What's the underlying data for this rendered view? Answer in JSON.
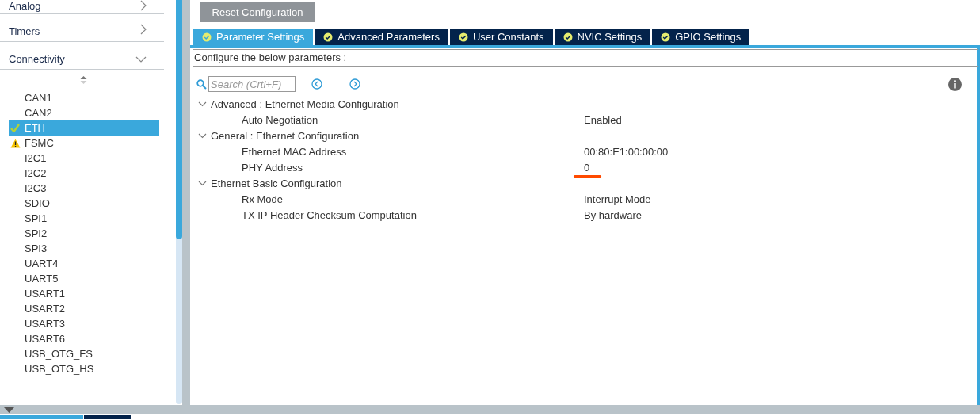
{
  "sidebar": {
    "categories": [
      {
        "label": "Analog",
        "expanded": false
      },
      {
        "label": "Timers",
        "expanded": false
      },
      {
        "label": "Connectivity",
        "expanded": true
      }
    ],
    "items": [
      {
        "label": "CAN1",
        "kind": "none",
        "selected": false
      },
      {
        "label": "CAN2",
        "kind": "none",
        "selected": false
      },
      {
        "label": "ETH",
        "kind": "ok",
        "selected": true
      },
      {
        "label": "FSMC",
        "kind": "warning",
        "selected": false
      },
      {
        "label": "I2C1",
        "kind": "none",
        "selected": false
      },
      {
        "label": "I2C2",
        "kind": "none",
        "selected": false
      },
      {
        "label": "I2C3",
        "kind": "none",
        "selected": false
      },
      {
        "label": "SDIO",
        "kind": "none",
        "selected": false
      },
      {
        "label": "SPI1",
        "kind": "none",
        "selected": false
      },
      {
        "label": "SPI2",
        "kind": "none",
        "selected": false
      },
      {
        "label": "SPI3",
        "kind": "none",
        "selected": false
      },
      {
        "label": "UART4",
        "kind": "none",
        "selected": false
      },
      {
        "label": "UART5",
        "kind": "none",
        "selected": false
      },
      {
        "label": "USART1",
        "kind": "none",
        "selected": false
      },
      {
        "label": "USART2",
        "kind": "none",
        "selected": false
      },
      {
        "label": "USART3",
        "kind": "none",
        "selected": false
      },
      {
        "label": "USART6",
        "kind": "none",
        "selected": false
      },
      {
        "label": "USB_OTG_FS",
        "kind": "none",
        "selected": false
      },
      {
        "label": "USB_OTG_HS",
        "kind": "none",
        "selected": false
      }
    ]
  },
  "reset_button": "Reset Configuration",
  "tabs": [
    {
      "label": "Parameter Settings",
      "selected": true
    },
    {
      "label": "Advanced Parameters",
      "selected": false
    },
    {
      "label": "User Constants",
      "selected": false
    },
    {
      "label": "NVIC Settings",
      "selected": false
    },
    {
      "label": "GPIO Settings",
      "selected": false
    }
  ],
  "description": "Configure the below parameters :",
  "search": {
    "placeholder": "Search (Crtl+F)"
  },
  "groups": [
    {
      "label": "Advanced : Ethernet Media Configuration",
      "expanded": true,
      "children": [
        {
          "label": "Auto Negotiation",
          "value": "Enabled",
          "annotated": false
        }
      ]
    },
    {
      "label": "General : Ethernet Configuration",
      "expanded": true,
      "children": [
        {
          "label": "Ethernet MAC Address",
          "value": "00:80:E1:00:00:00",
          "annotated": false
        },
        {
          "label": "PHY Address",
          "value": "0",
          "annotated": true
        }
      ]
    },
    {
      "label": "Ethernet Basic Configuration",
      "expanded": true,
      "children": [
        {
          "label": "Rx Mode",
          "value": "Interrupt Mode",
          "annotated": false
        },
        {
          "label": "TX IP Header Checksum Computation",
          "value": "By hardware",
          "annotated": false
        }
      ]
    }
  ]
}
